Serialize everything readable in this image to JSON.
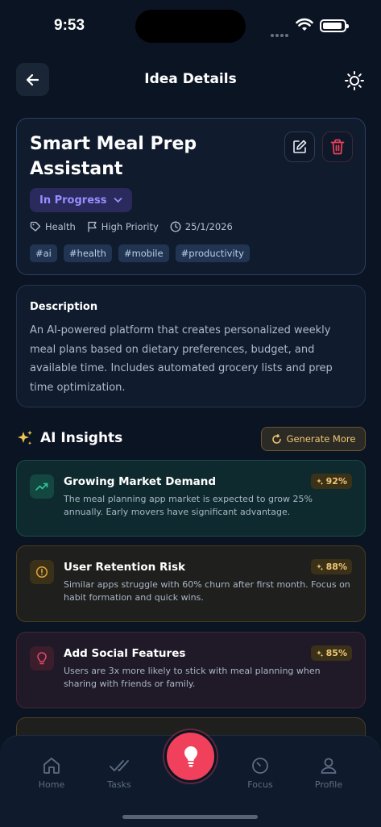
{
  "status_bar": {
    "time": "9:53"
  },
  "header": {
    "title": "Idea Details"
  },
  "idea": {
    "title": "Smart Meal Prep Assistant",
    "status": "In Progress",
    "category": "Health",
    "priority": "High Priority",
    "date": "25/1/2026",
    "tags": [
      "#ai",
      "#health",
      "#mobile",
      "#productivity"
    ]
  },
  "description": {
    "label": "Description",
    "text": "An AI-powered platform that creates personalized weekly meal plans based on dietary preferences, budget, and available time. Includes automated grocery lists and prep time optimization."
  },
  "ai_insights": {
    "title": "AI Insights",
    "generate_label": "Generate More",
    "items": [
      {
        "title": "Growing Market Demand",
        "score": "92%",
        "text": "The meal planning app market is expected to grow 25% annually. Early movers have significant advantage.",
        "icon": "trending-up-icon",
        "color": "#2ec4a0"
      },
      {
        "title": "User Retention Risk",
        "score": "88%",
        "text": "Similar apps struggle with 60% churn after first month. Focus on habit formation and quick wins.",
        "icon": "alert-circle-icon",
        "color": "#e0a53a"
      },
      {
        "title": "Add Social Features",
        "score": "85%",
        "text": "Users are 3x more likely to stick with meal planning when sharing with friends or family.",
        "icon": "lightbulb-icon",
        "color": "#e0486b"
      }
    ]
  },
  "tabbar": {
    "home": "Home",
    "tasks": "Tasks",
    "focus": "Focus",
    "profile": "Profile"
  },
  "colors": {
    "accent": "#f0405c",
    "status": "#9b8cff",
    "background": "#0b1423"
  }
}
